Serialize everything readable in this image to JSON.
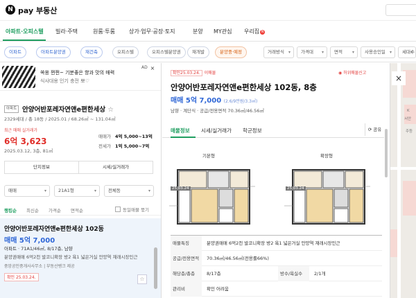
{
  "header": {
    "logo_letter": "N",
    "logo_text": "pay 부동산"
  },
  "nav": {
    "items": [
      "아파트·오피스텔",
      "빌라·주택",
      "원룸·투룸",
      "상가·업무·공장·토지",
      "분양",
      "MY관심",
      "우리집"
    ],
    "new_badge": "N"
  },
  "filters": {
    "chips": [
      "이파트",
      "아파트분양권",
      "재건축",
      "오피스텔",
      "오피스텔분양권",
      "재개발",
      "분양중·예정"
    ],
    "selects": [
      "거래방식",
      "가격대",
      "면적",
      "사용승인일",
      "세대수"
    ]
  },
  "ad": {
    "title": "쏙쏭 쩐쩐~ 기분좋은 향과 맛의 매력",
    "subtitle": "식사대용 인기 충전 뽀♡",
    "badge": "AD",
    "close": "×"
  },
  "complex": {
    "tag": "아파트",
    "name": "안양어반포레자연앤e편한세상",
    "star": "☆",
    "meta": "2329세대 / 총 18동 / 2025.01 / 68.26㎡ ~ 131.04㎡",
    "caption": "최근 매매 실거래가",
    "price": "6억 3,623",
    "date": "2025.03.12, 3층, 81㎡",
    "ranges": [
      {
        "label": "매매가",
        "value": "4억 5,000~13억"
      },
      {
        "label": "전세가",
        "value": "1억 5,000~7억"
      }
    ],
    "buttons": [
      "단지정보",
      "시세/실거래가"
    ]
  },
  "list_controls": {
    "selects": [
      "매매",
      "21A1형",
      "전체동"
    ],
    "tabs": [
      "랭킹순",
      "최신순",
      "가격순",
      "면적순"
    ],
    "checkbox": "동일매물 묶기"
  },
  "listing": {
    "title": "안양어반포레자연앤e편한세상 102동",
    "price": "매매 5억 7,000",
    "meta": "아파트 · 71A1/46㎡, 8/17층, 남향",
    "desc": "분양권매매 6억2천 발코니확장 방2 욕1 넓은거실 안양역 재래시장인근",
    "agency": "중앙공인중개사사무소 | 부동산뱅크 제공",
    "confirm": "확인 25.03.24.",
    "star": "☆"
  },
  "detail": {
    "confirm_tag": "확인25.03.24.",
    "confirm_source": "이매물",
    "report": "허위매물신고",
    "title": "안양어반포레자연앤e편한세상 102동, 8층",
    "price": "매매 5억 7,000",
    "price_sub": "(2.6/9만원/3.3㎡)",
    "meta": "남향 · 계단식 · 공급/전용면적 70.36㎡/46.56㎡",
    "tabs": [
      "매물정보",
      "시세/실거래가",
      "학군정보"
    ],
    "share": "공유",
    "plans": [
      {
        "label": "기본형",
        "date": "25.03.24"
      },
      {
        "label": "확장형",
        "date": "25.03.24"
      }
    ],
    "info": [
      {
        "label": "매물특징",
        "value": "분양권매매 6억2천 발코니확장 방2 욕1 넓은거실 안양역 재래시장인근"
      },
      {
        "label": "공급/전용면적",
        "value": "70.36㎡/46.56㎡(전용률66%)"
      },
      {
        "label": "해당층/총층",
        "value": "8/17층",
        "label2": "방수/욕실수",
        "value2": "2/1개"
      },
      {
        "label": "관리비",
        "value": "확인 어려움"
      }
    ]
  },
  "map": {
    "close": "×",
    "labels": [
      "K",
      "서안",
      "주등"
    ]
  },
  "colors": {
    "accent": "#1f9e60",
    "price_red": "#e02f2a",
    "price_blue": "#2e66d6"
  }
}
